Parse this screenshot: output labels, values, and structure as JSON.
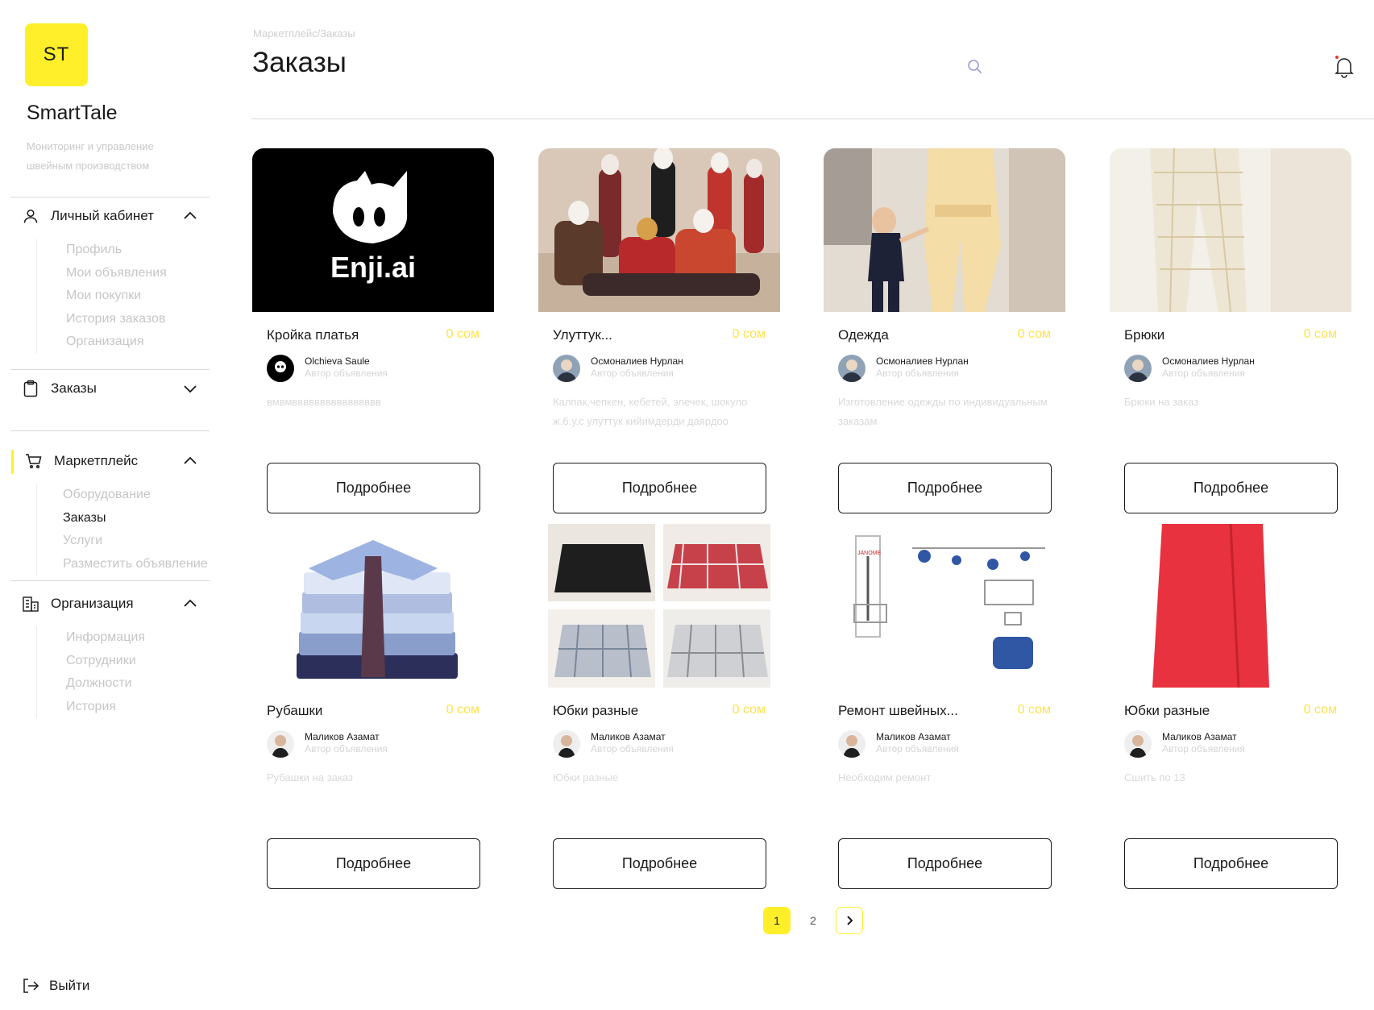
{
  "sidebar": {
    "logo": "ST",
    "app_name": "SmartTale",
    "tagline": "Мониторинг и управление швейным производством",
    "sections": [
      {
        "label": "Личный кабинет",
        "items": [
          "Профиль",
          "Мои объявления",
          "Мои покупки",
          "История заказов",
          "Организация"
        ]
      },
      {
        "label": "Заказы",
        "items": []
      },
      {
        "label": "Маркетплейс",
        "items": [
          "Оборудование",
          "Заказы",
          "Услуги",
          "Разместить объявление"
        ]
      },
      {
        "label": "Организация",
        "items": [
          "Информация",
          "Сотрудники",
          "Должности",
          "История"
        ]
      }
    ],
    "logout": "Выйти"
  },
  "header": {
    "breadcrumb": "Маркетплейс/Заказы",
    "title": "Заказы"
  },
  "cards": [
    {
      "title": "Кройка платья",
      "price": "0 сом",
      "author": "Olchieva Saule",
      "role": "Автор объявления",
      "desc": "вмвмвввввввввввввввв",
      "button": "Подробнее",
      "image_label": "Enji.ai"
    },
    {
      "title": "Улуттук...",
      "price": "0 сом",
      "author": "Осмоналиев Нурлан",
      "role": "Автор объявления",
      "desc": "Калпак,чепкен, кебетей, элечек, шокуло ж.б.у.с улуттук кийимдерди даярдоо",
      "button": "Подробнее"
    },
    {
      "title": "Одежда",
      "price": "0 сом",
      "author": "Осмоналиев Нурлан",
      "role": "Автор объявления",
      "desc": "Изготовление одежды по индивидуальным заказам",
      "button": "Подробнее"
    },
    {
      "title": "Брюки",
      "price": "0 сом",
      "author": "Осмоналиев Нурлан",
      "role": "Автор объявления",
      "desc": "Брюки на заказ",
      "button": "Подробнее"
    },
    {
      "title": "Рубашки",
      "price": "0 сом",
      "author": "Маликов Азамат",
      "role": "Автор объявления",
      "desc": "Рубашки на заказ",
      "button": "Подробнее"
    },
    {
      "title": "Юбки разные",
      "price": "0 сом",
      "author": "Маликов Азамат",
      "role": "Автор объявления",
      "desc": "Юбки разные",
      "button": "Подробнее"
    },
    {
      "title": "Ремонт швейных...",
      "price": "0 сом",
      "author": "Маликов Азамат",
      "role": "Автор объявления",
      "desc": "Необходим ремонт",
      "button": "Подробнее",
      "image_label": "JANOME"
    },
    {
      "title": "Юбки разные",
      "price": "0 сом",
      "author": "Маликов Азамат",
      "role": "Автор объявления",
      "desc": "Сшить по 13",
      "button": "Подробнее"
    }
  ],
  "pagination": {
    "pages": [
      "1",
      "2"
    ],
    "current": "1"
  },
  "colors": {
    "accent": "#FFEF2B",
    "price": "#FFE24A",
    "text": "#1a1a1a",
    "muted": "#c6c6c6"
  }
}
